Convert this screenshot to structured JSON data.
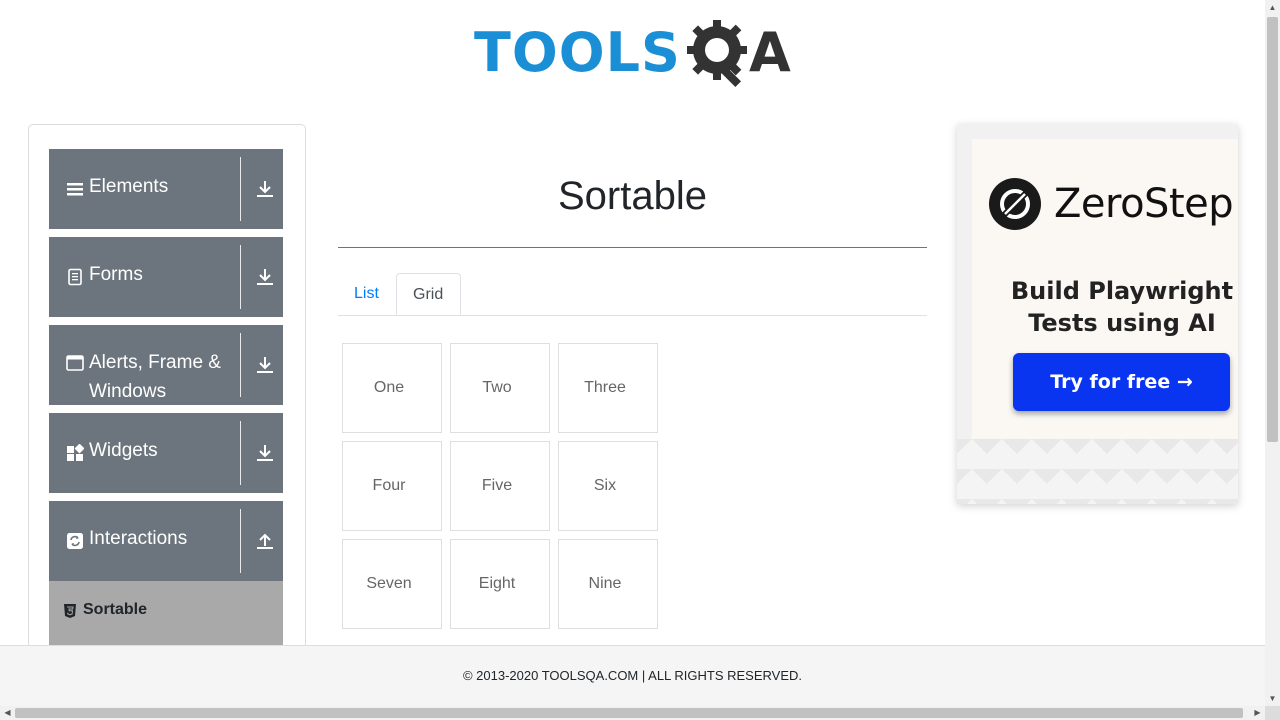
{
  "header": {
    "logo_text_main": "TOOLS",
    "logo_text_end": "A",
    "logo_icon": "gear-magnifier-q-icon"
  },
  "sidebar": {
    "groups": [
      {
        "label": "Elements",
        "icon": "hamburger-list-icon",
        "arrow": "download-arrow-icon"
      },
      {
        "label": "Forms",
        "icon": "document-icon",
        "arrow": "download-arrow-icon"
      },
      {
        "label": "Alerts, Frame & Windows",
        "icon": "browser-window-icon",
        "arrow": "download-arrow-icon"
      },
      {
        "label": "Widgets",
        "icon": "widgets-grid-icon",
        "arrow": "download-arrow-icon"
      },
      {
        "label": "Interactions",
        "icon": "refresh-cycle-icon",
        "arrow": "upload-arrow-icon"
      }
    ],
    "active_item": {
      "label": "Sortable",
      "icon": "html5-icon"
    }
  },
  "main": {
    "title": "Sortable",
    "tabs": [
      {
        "label": "List",
        "active": false
      },
      {
        "label": "Grid",
        "active": true
      }
    ],
    "grid_items": [
      "One",
      "Two",
      "Three",
      "Four",
      "Five",
      "Six",
      "Seven",
      "Eight",
      "Nine"
    ]
  },
  "ad": {
    "brand": "ZeroStep",
    "tagline": "Build Playwright Tests using AI",
    "cta": "Try for free →"
  },
  "footer": {
    "copyright": "© 2013-2020 TOOLSQA.COM | ALL RIGHTS RESERVED."
  },
  "colors": {
    "logo_blue": "#1a8fd6",
    "sidebar_group_bg": "#6c757d",
    "sidebar_active_bg": "#a9a9a9",
    "link_blue": "#007bff",
    "ad_cta_blue": "#0a35f0"
  }
}
